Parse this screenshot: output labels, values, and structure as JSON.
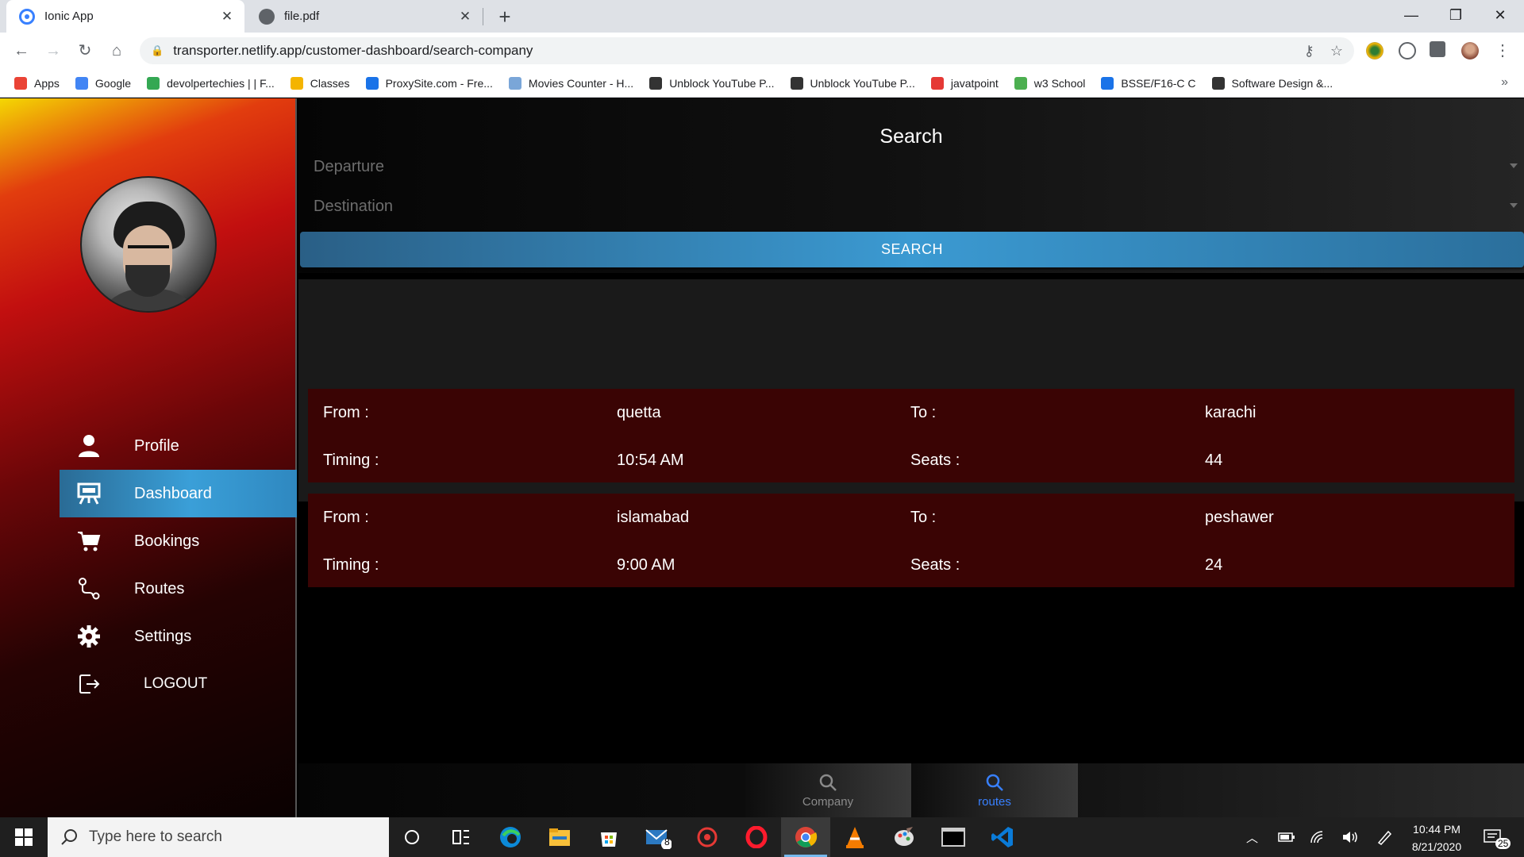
{
  "browser": {
    "tabs": [
      {
        "title": "Ionic App",
        "active": true
      },
      {
        "title": "file.pdf",
        "active": false
      }
    ],
    "url": "transporter.netlify.app/customer-dashboard/search-company",
    "bookmarks": [
      {
        "label": "Apps",
        "icon": "apps-grid-icon",
        "color": "#ea4335"
      },
      {
        "label": "Google",
        "icon": "google-icon",
        "color": "#4285f4"
      },
      {
        "label": "devolpertechies | | F...",
        "icon": "devtechies-icon",
        "color": "#34a853"
      },
      {
        "label": "Classes",
        "icon": "classes-icon",
        "color": "#f4b400"
      },
      {
        "label": "ProxySite.com - Fre...",
        "icon": "shield-icon",
        "color": "#1a73e8"
      },
      {
        "label": "Movies Counter - H...",
        "icon": "movies-icon",
        "color": "#7aa6d8"
      },
      {
        "label": "Unblock YouTube P...",
        "icon": "shield-icon",
        "color": "#333333"
      },
      {
        "label": "Unblock YouTube P...",
        "icon": "shield-icon",
        "color": "#333333"
      },
      {
        "label": "javatpoint",
        "icon": "javatpoint-icon",
        "color": "#e53935"
      },
      {
        "label": "w3 School",
        "icon": "w3school-icon",
        "color": "#4caf50"
      },
      {
        "label": "BSSE/F16-C C",
        "icon": "classroom-icon",
        "color": "#1a73e8"
      },
      {
        "label": "Software Design &...",
        "icon": "classroom-icon",
        "color": "#333333"
      }
    ]
  },
  "sidebar": {
    "avatar_icon": "profile-photo",
    "items": [
      {
        "label": "Profile",
        "icon": "person-icon",
        "active": false
      },
      {
        "label": "Dashboard",
        "icon": "easel-icon",
        "active": true
      },
      {
        "label": "Bookings",
        "icon": "cart-icon",
        "active": false
      },
      {
        "label": "Routes",
        "icon": "route-icon",
        "active": false
      },
      {
        "label": "Settings",
        "icon": "gear-icon",
        "active": false
      },
      {
        "label": "LOGOUT",
        "icon": "logout-icon",
        "active": false
      }
    ]
  },
  "search": {
    "title": "Search",
    "departure_placeholder": "Departure",
    "destination_placeholder": "Destination",
    "button_label": "SEARCH"
  },
  "results": {
    "labels": {
      "from": "From :",
      "to": "To :",
      "timing": "Timing :",
      "seats": "Seats :"
    },
    "rows": [
      {
        "from": "quetta",
        "to": "karachi",
        "timing": "10:54 AM",
        "seats": "44"
      },
      {
        "from": "islamabad",
        "to": "peshawer",
        "timing": "9:00 AM",
        "seats": "24"
      }
    ]
  },
  "bottom_tabs": [
    {
      "label": "Company",
      "icon": "search-icon",
      "selected": false
    },
    {
      "label": "routes",
      "icon": "search-icon",
      "selected": true
    }
  ],
  "taskbar": {
    "search_placeholder": "Type here to search",
    "mail_badge": "8",
    "time": "10:44 PM",
    "date": "8/21/2020",
    "notification_count": "25"
  },
  "colors": {
    "accent_blue": "#3b9ad2",
    "card_bg": "#3a0404",
    "tab_selected": "#3880ff"
  }
}
